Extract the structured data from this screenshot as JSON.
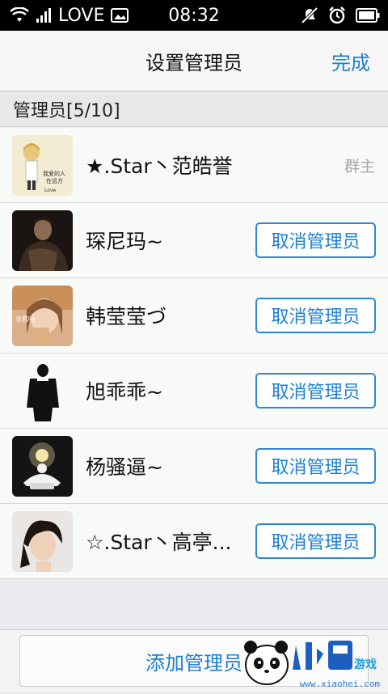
{
  "status_bar": {
    "carrier": "LOVE",
    "time": "08:32"
  },
  "nav": {
    "title": "设置管理员",
    "done_label": "完成"
  },
  "section": {
    "header": "管理员[5/10]"
  },
  "members": [
    {
      "name": "★.Star丶范皓誉",
      "role_label": "群主",
      "avatar": "avatar-illustration"
    },
    {
      "name": "琛尼玛~",
      "action_label": "取消管理员",
      "avatar": "avatar-photo-man"
    },
    {
      "name": "韩莹莹づ",
      "action_label": "取消管理员",
      "avatar": "avatar-photo-girl"
    },
    {
      "name": "旭乖乖~",
      "action_label": "取消管理员",
      "avatar": "avatar-silhouette"
    },
    {
      "name": "杨骚逼~",
      "action_label": "取消管理员",
      "avatar": "avatar-meditation"
    },
    {
      "name": "☆.Star丶高亭...",
      "action_label": "取消管理员",
      "avatar": "avatar-photo-boy"
    }
  ],
  "bottom": {
    "add_label": "添加管理员"
  },
  "watermark": {
    "brand": "小黑游戏",
    "url": "www.xiaohei.com"
  },
  "colors": {
    "accent": "#1c7fd6",
    "row_bg": "#f8faf7",
    "page_bg": "#ebebef",
    "status_bar": "#000000"
  }
}
